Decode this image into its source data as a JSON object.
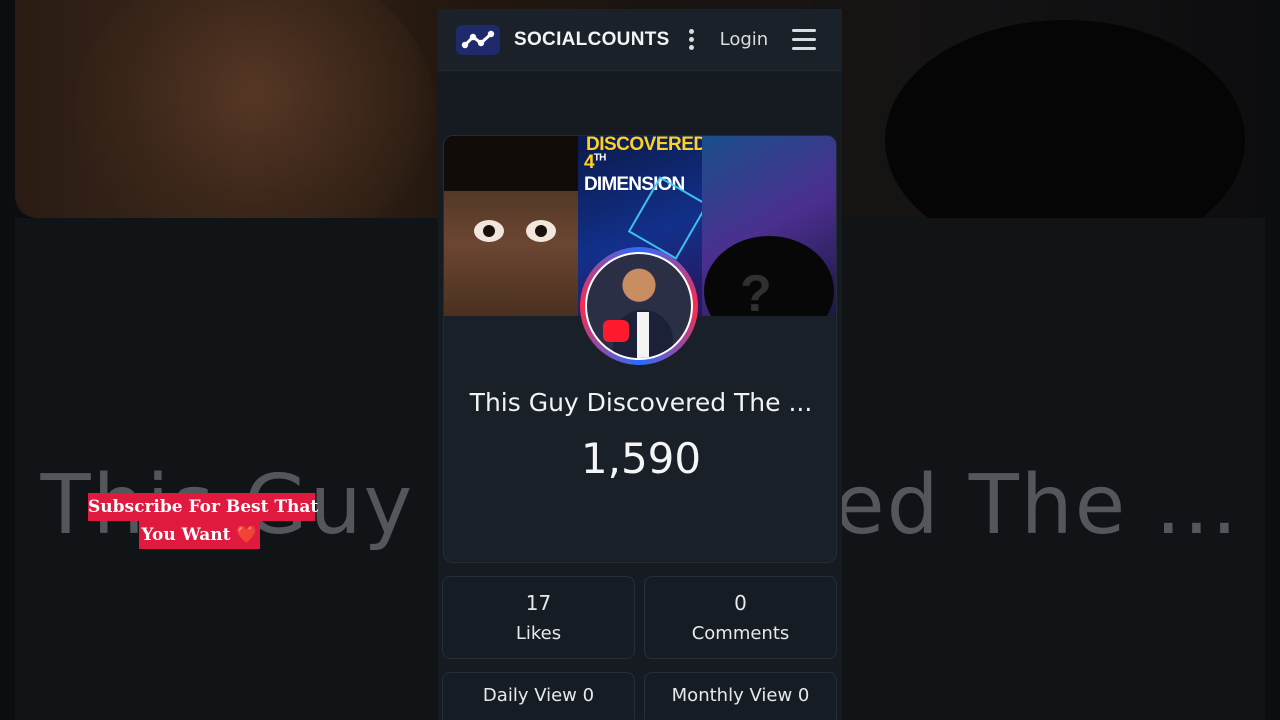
{
  "header": {
    "brand": "SOCIALCOUNTS",
    "login_label": "Login"
  },
  "background": {
    "title_left": "This Guy",
    "title_right": "ed The ..."
  },
  "banner": {
    "line1": "DISCOVERED",
    "line2_prefix": "4",
    "line2_sup": "TH",
    "line2_suffix": " DIMENSION",
    "question_mark": "?"
  },
  "video": {
    "title": "This Guy Discovered The ...",
    "view_count": "1,590"
  },
  "caption": {
    "line1": "Subscribe For Best That",
    "line2": "You Want ❤️"
  },
  "stats": {
    "likes_value": "17",
    "likes_label": "Likes",
    "comments_value": "0",
    "comments_label": "Comments",
    "daily_view": "Daily View 0",
    "monthly_view": "Monthly View 0"
  },
  "colors": {
    "accent_red": "#e0193f",
    "brand_blue": "#1e2a6b",
    "panel_bg": "#161b22"
  }
}
